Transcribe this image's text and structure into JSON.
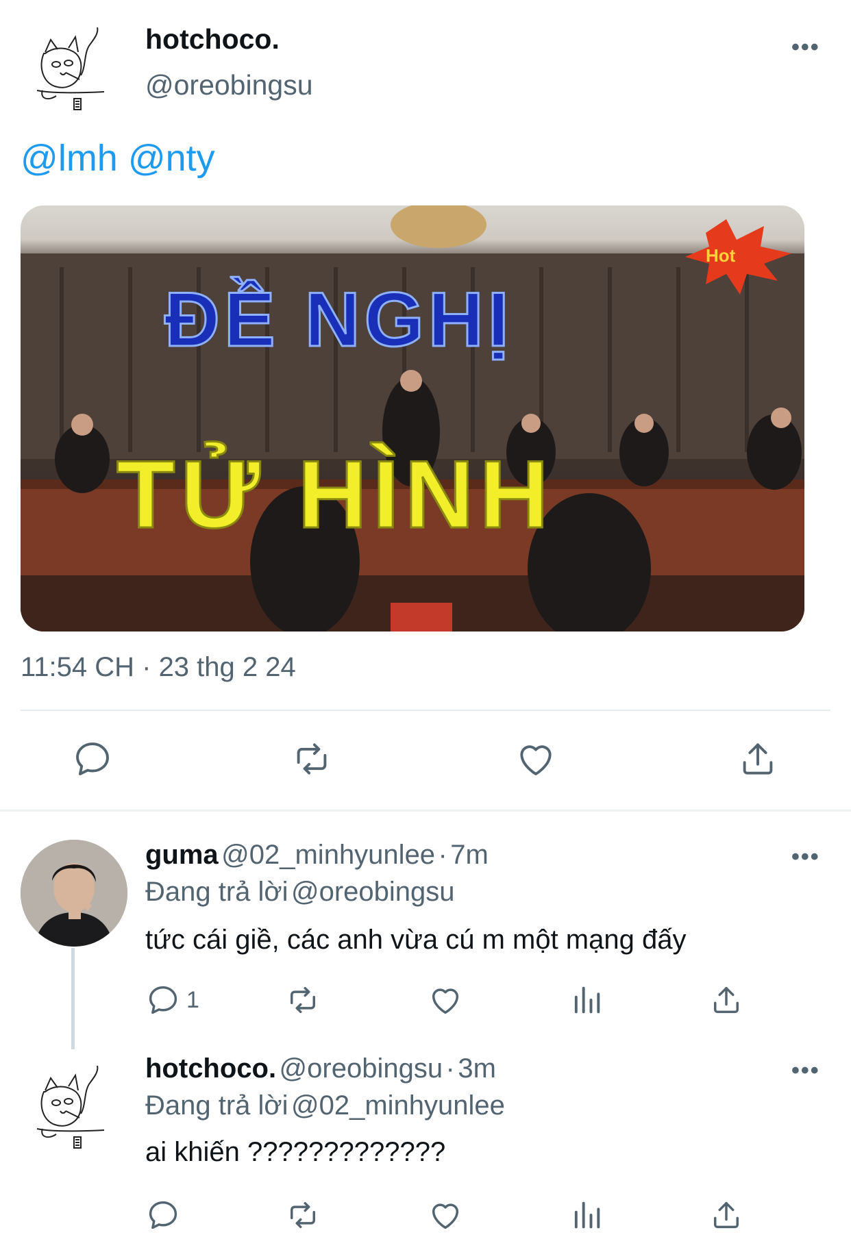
{
  "main_tweet": {
    "author_name": "hotchoco.",
    "author_handle": "@oreobingsu",
    "text": "@lmh @nty",
    "media": {
      "line1": "ĐỀ NGHỊ",
      "line2": "TỬ HÌNH",
      "badge": "Hot"
    },
    "timestamp": "11:54 CH · 23 thg 2 24",
    "more_label": "•••"
  },
  "replies": [
    {
      "author_name": "guma",
      "author_handle": "@02_minhyunlee",
      "sep": "·",
      "time": "7m",
      "replying_prefix": "Đang trả lời",
      "replying_to": "@oreobingsu",
      "text": "tức cái giề, các anh vừa cú m một mạng đấy",
      "reply_count": "1",
      "more_label": "•••"
    },
    {
      "author_name": "hotchoco.",
      "author_handle": "@oreobingsu",
      "sep": "·",
      "time": "3m",
      "replying_prefix": "Đang trả lời",
      "replying_to": "@02_minhyunlee",
      "text": "ai khiến ?????????????",
      "reply_count": "",
      "more_label": "•••"
    }
  ],
  "colors": {
    "accent": "#1d9bf0",
    "secondary_text": "#536471",
    "media_text_blue": "#1a2fb8",
    "media_text_yellow": "#f2ef2a"
  },
  "icons": [
    "reply-icon",
    "retweet-icon",
    "like-icon",
    "share-icon",
    "views-icon",
    "more-icon"
  ]
}
